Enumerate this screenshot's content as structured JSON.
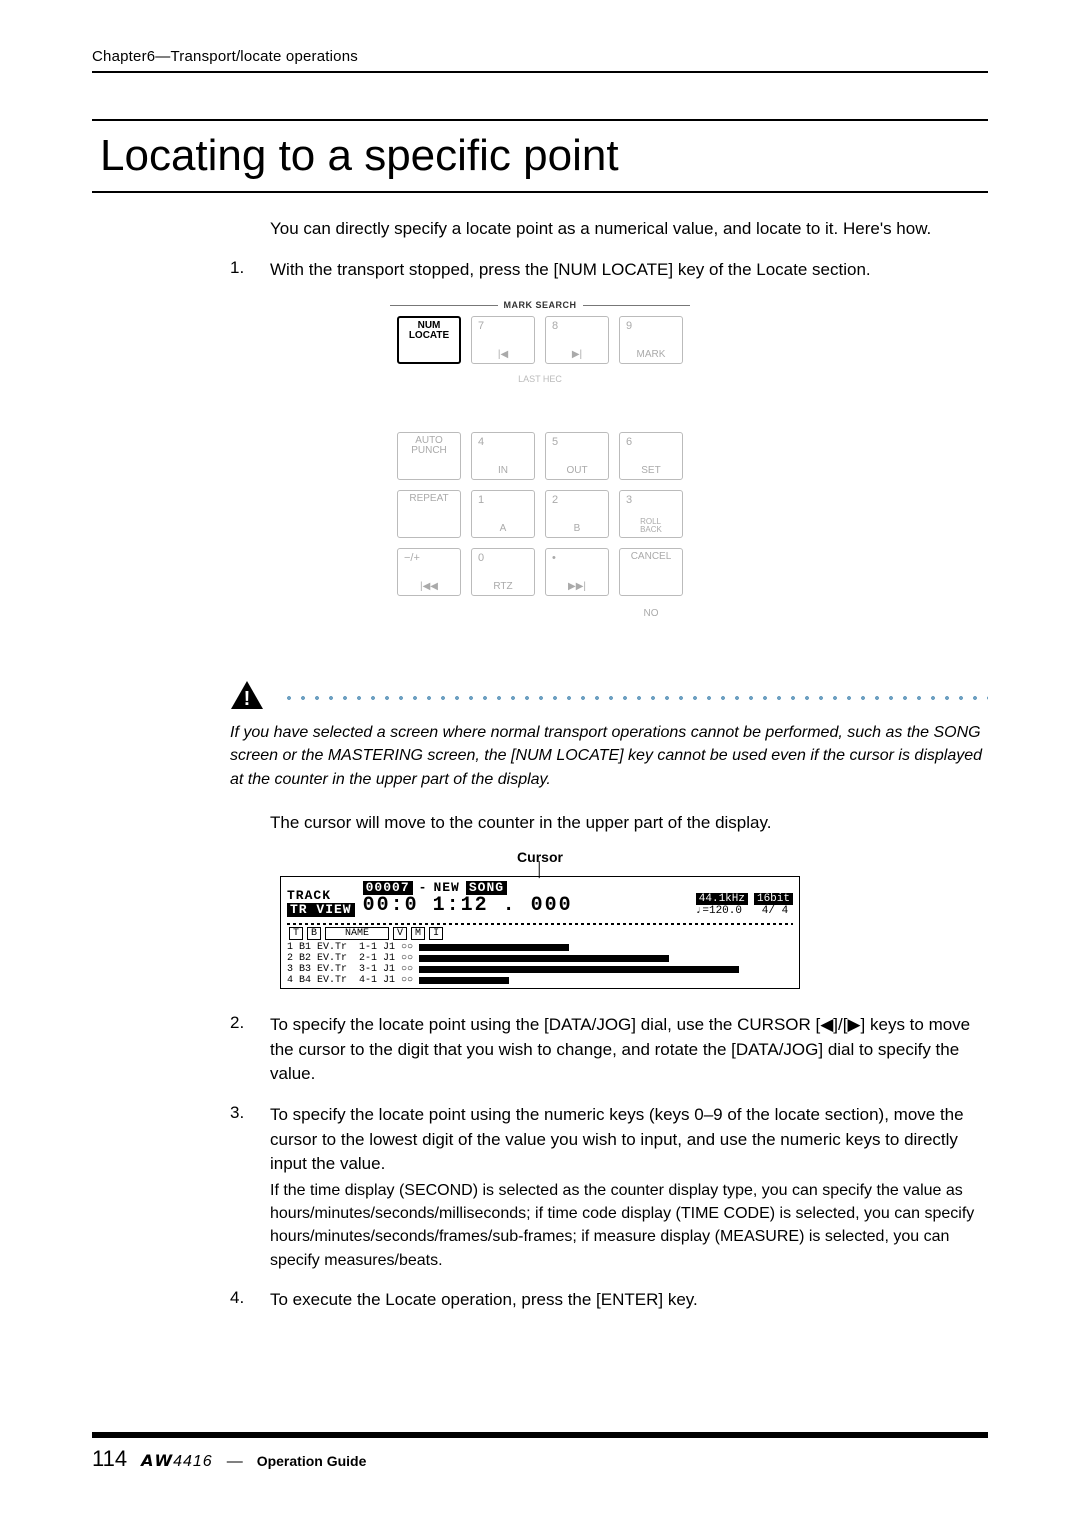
{
  "running_head": "Chapter6—Transport/locate operations",
  "h1": "Locating to a speciﬁc point",
  "intro": "You can directly specify a locate point as a numerical value, and locate to it. Here's how.",
  "steps": {
    "s1": {
      "num": "1.",
      "text": "With the transport stopped, press the [NUM LOCATE] key of the Locate section."
    },
    "s2": {
      "num": "2.",
      "text": "To specify the locate point using the [DATA/JOG] dial, use the CURSOR [◀]/[▶] keys to move the cursor to the digit that you wish to change, and rotate the [DATA/JOG] dial to specify the value."
    },
    "s3": {
      "num": "3.",
      "text": "To specify the locate point using the numeric keys (keys 0–9 of the locate section), move the cursor to the lowest digit of the value you wish to input, and use the numeric keys to directly input the value.",
      "sub": "If the time display (SECOND) is selected as the counter display type, you can specify the value as hours/minutes/seconds/milliseconds; if time code display (TIME CODE) is selected, you can specify hours/minutes/seconds/frames/sub-frames; if measure display (MEASURE) is selected, you can specify measures/beats."
    },
    "s4": {
      "num": "4.",
      "text": "To execute the Locate operation, press the [ENTER] key."
    }
  },
  "keypad": {
    "header": "MARK SEARCH",
    "lasthec": "LAST HEC",
    "btns": {
      "num_locate": "NUM\nLOCATE",
      "b7": {
        "n": "7",
        "sym": "|◀"
      },
      "b8": {
        "n": "8",
        "sym": "▶|"
      },
      "b9": {
        "n": "9",
        "lbl": "MARK"
      },
      "auto_punch": "AUTO\nPUNCH",
      "b4": {
        "n": "4",
        "lbl": "IN"
      },
      "b5": {
        "n": "5",
        "lbl": "OUT"
      },
      "b6": {
        "n": "6",
        "lbl": "SET"
      },
      "repeat": "REPEAT",
      "b1": {
        "n": "1",
        "lbl": "A"
      },
      "b2": {
        "n": "2",
        "lbl": "B"
      },
      "b3": {
        "n": "3",
        "lbl": "ROLL\nBACK"
      },
      "rew": {
        "n": "−/+",
        "sym": "|◀◀"
      },
      "b0": {
        "n": "0",
        "lbl": "RTZ"
      },
      "enter": {
        "n": "•",
        "sym": "▶▶|"
      },
      "cancel": "CANCEL",
      "no": "NO"
    }
  },
  "warning": "If you have selected a screen where normal transport operations cannot be performed, such as the SONG screen or the MASTERING screen, the [NUM LOCATE] key cannot be used even if the cursor is displayed at the counter in the upper part of the display.",
  "after_warn": "The cursor will move to the counter in the upper part of the display.",
  "lcd": {
    "cursor_label": "Cursor",
    "track": "TRACK",
    "tr_view": "TR VIEW",
    "song_id": "00007",
    "dash": "-",
    "song_suffix": "NEW",
    "song_word": "SONG",
    "counter": "00:0 1:12 . 000",
    "badge1": "44.1kHz",
    "badge2": "16bit",
    "tempo": "♩=120.0",
    "meter": "4/ 4",
    "head": {
      "t": "T",
      "b": "B",
      "name": "NAME",
      "v": "V",
      "m": "M",
      "i": "I"
    },
    "rows": [
      "1 B1 EV.Tr  1-1 J1 ○○",
      "2 B2 EV.Tr  2-1 J1 ○○",
      "3 B3 EV.Tr  3-1 J1 ○○",
      "4 B4 EV.Tr  4-1 J1 ○○"
    ]
  },
  "footer": {
    "page": "114",
    "product": "𝘼𝙒4416",
    "sep": "—",
    "guide": "Operation Guide"
  }
}
